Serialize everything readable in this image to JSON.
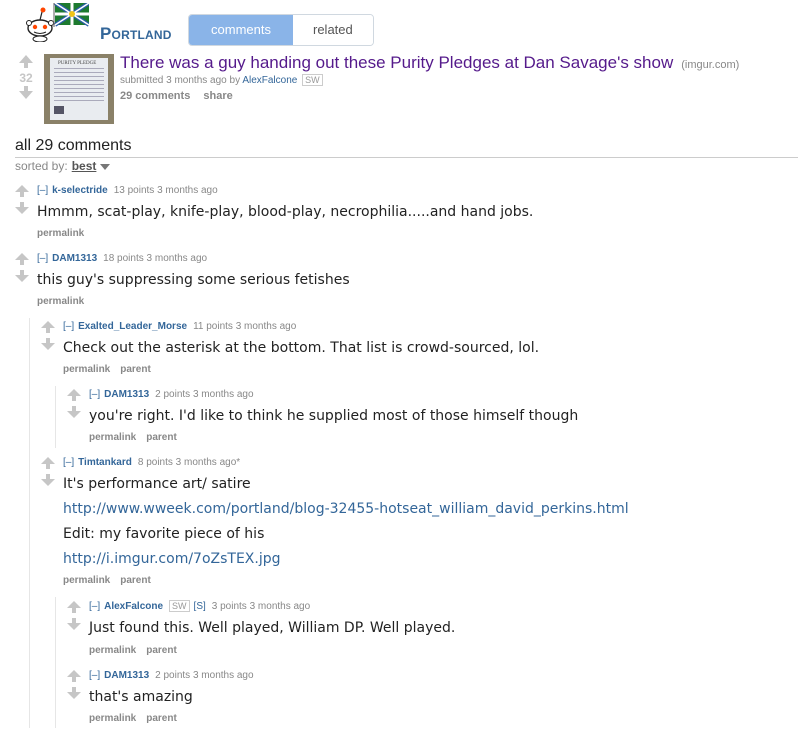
{
  "header": {
    "subreddit": "Portland",
    "tabs": [
      {
        "label": "comments",
        "active": true
      },
      {
        "label": "related",
        "active": false
      }
    ],
    "accent": "#8ab4e8"
  },
  "post": {
    "score": "32",
    "title": "There was a guy handing out these Purity Pledges at Dan Savage's show",
    "domain": "(imgur.com)",
    "submitted_prefix": "submitted 3 months ago by",
    "author": "AlexFalcone",
    "author_flair": "SW",
    "comments_count": "29 comments",
    "share": "share",
    "thumbnail_caption": "PURITY PLEDGE"
  },
  "comments_section": {
    "title": "all 29 comments",
    "sorted_by_label": "sorted by:",
    "sort_value": "best"
  },
  "comments": [
    {
      "toggle": "[–]",
      "author": "k-selectride",
      "meta": "13 points 3 months ago",
      "body": [
        "Hmmm, scat-play, knife-play, blood-play, necrophilia.....and hand jobs."
      ],
      "actions": [
        "permalink"
      ]
    },
    {
      "toggle": "[–]",
      "author": "DAM1313",
      "meta": "18 points 3 months ago",
      "body": [
        "this guy's suppressing some serious fetishes"
      ],
      "actions": [
        "permalink"
      ]
    },
    {
      "toggle": "[–]",
      "author": "Exalted_Leader_Morse",
      "meta": "11 points 3 months ago",
      "body": [
        "Check out the asterisk at the bottom. That list is crowd-sourced, lol."
      ],
      "actions": [
        "permalink",
        "parent"
      ]
    },
    {
      "toggle": "[–]",
      "author": "DAM1313",
      "meta": "2 points 3 months ago",
      "body": [
        "you're right. I'd like to think he supplied most of those himself though"
      ],
      "actions": [
        "permalink",
        "parent"
      ]
    },
    {
      "toggle": "[–]",
      "author": "Timtankard",
      "meta": "8 points 3 months ago*",
      "body": [
        "It's performance art/ satire",
        "http://www.wweek.com/portland/blog-32455-hotseat_william_david_perkins.html",
        "Edit: my favorite piece of his",
        "http://i.imgur.com/7oZsTEX.jpg"
      ],
      "actions": [
        "permalink",
        "parent"
      ]
    },
    {
      "toggle": "[–]",
      "author": "AlexFalcone",
      "flair": "SW",
      "sflag": "[S]",
      "meta": "3 points 3 months ago",
      "body": [
        "Just found this. Well played, William DP. Well played."
      ],
      "actions": [
        "permalink",
        "parent"
      ]
    },
    {
      "toggle": "[–]",
      "author": "DAM1313",
      "meta": "2 points 3 months ago",
      "body": [
        "that's amazing"
      ],
      "actions": [
        "permalink",
        "parent"
      ]
    }
  ]
}
